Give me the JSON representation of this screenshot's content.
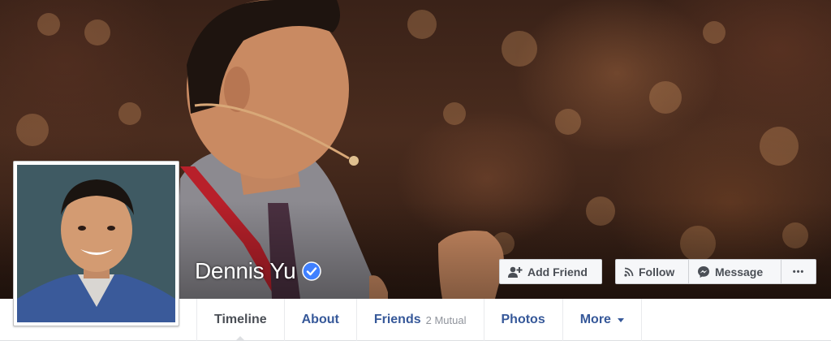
{
  "profile": {
    "name": "Dennis Yu",
    "verified": true
  },
  "actions": {
    "add_friend_label": "Add Friend",
    "follow_label": "Follow",
    "message_label": "Message",
    "more_label": "•••"
  },
  "tabs": [
    {
      "label": "Timeline",
      "active": true
    },
    {
      "label": "About"
    },
    {
      "label": "Friends",
      "sub": "2 Mutual"
    },
    {
      "label": "Photos"
    },
    {
      "label": "More"
    }
  ],
  "colors": {
    "link": "#365899",
    "verified": "#4080ff",
    "button_bg": "#f6f7f9"
  }
}
